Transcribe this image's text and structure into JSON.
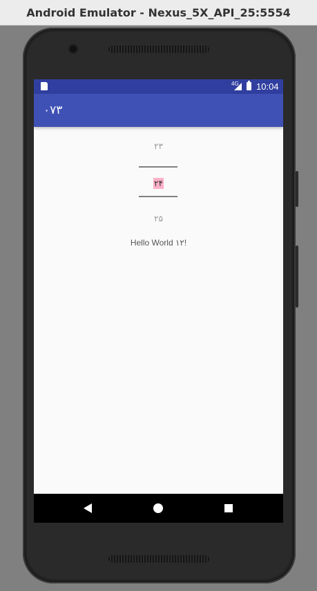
{
  "window": {
    "title": "Android Emulator - Nexus_5X_API_25:5554"
  },
  "status_bar": {
    "network": "4G",
    "time": "10:04"
  },
  "app_bar": {
    "title": "۰۷۳"
  },
  "number_picker": {
    "previous": "۲۳",
    "selected": "۲۴",
    "next": "۲۵",
    "selected_bg": "#ffb0c8"
  },
  "content": {
    "hello_text": "Hello World ۱۲!"
  },
  "colors": {
    "status_bar": "#303f9f",
    "app_bar": "#3f51b5",
    "screen_bg": "#fafafa"
  }
}
